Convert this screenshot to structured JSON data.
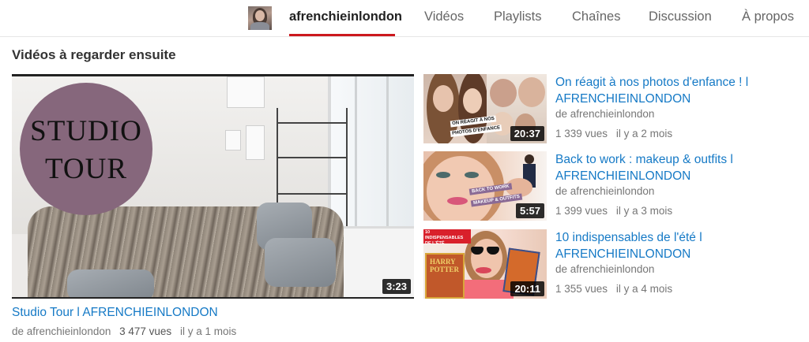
{
  "channel": {
    "name": "afrenchieinlondon"
  },
  "nav": {
    "tabs": [
      "afrenchieinlondon",
      "Vidéos",
      "Playlists",
      "Chaînes",
      "Discussion",
      "À propos"
    ]
  },
  "section": {
    "title": "Vidéos à regarder ensuite"
  },
  "featured": {
    "title": "Studio Tour l AFRENCHIEINLONDON",
    "thumb_text_line1": "STUDIO",
    "thumb_text_line2": "TOUR",
    "duration": "3:23",
    "channel": "de afrenchieinlondon",
    "views": "3 477 vues",
    "age": "il y a 1 mois"
  },
  "videos": [
    {
      "title_line1": "On réagit à nos photos d'enfance ! l",
      "title_line2": "AFRENCHIEINLONDON",
      "duration": "20:37",
      "channel": "de afrenchieinlondon",
      "views": "1 339 vues",
      "age": "il y a 2 mois",
      "thumb_tag1": "ON RÉAGIT À NOS",
      "thumb_tag2": "PHOTOS D'ENFANCE"
    },
    {
      "title_line1": "Back to work : makeup & outfits l",
      "title_line2": "AFRENCHIEINLONDON",
      "duration": "5:57",
      "channel": "de afrenchieinlondon",
      "views": "1 399 vues",
      "age": "il y a 3 mois",
      "thumb_tag1": "BACK TO WORK",
      "thumb_tag2": "MAKEUP & OUTFITS"
    },
    {
      "title_line1": "10 indispensables de l'été l",
      "title_line2": "AFRENCHIEINLONDON",
      "duration": "20:11",
      "channel": "de afrenchieinlondon",
      "views": "1 355 vues",
      "age": "il y a 4 mois",
      "thumb_banner1": "10",
      "thumb_banner2": "INDISPENSABLES DE L'ÉTÉ",
      "thumb_book1": "HARRY",
      "thumb_book2": "POTTER"
    }
  ],
  "colors": {
    "link": "#167ac6",
    "active_tab": "#cc181e",
    "meta": "#767676"
  },
  "icons": [
    "channel-avatar"
  ]
}
